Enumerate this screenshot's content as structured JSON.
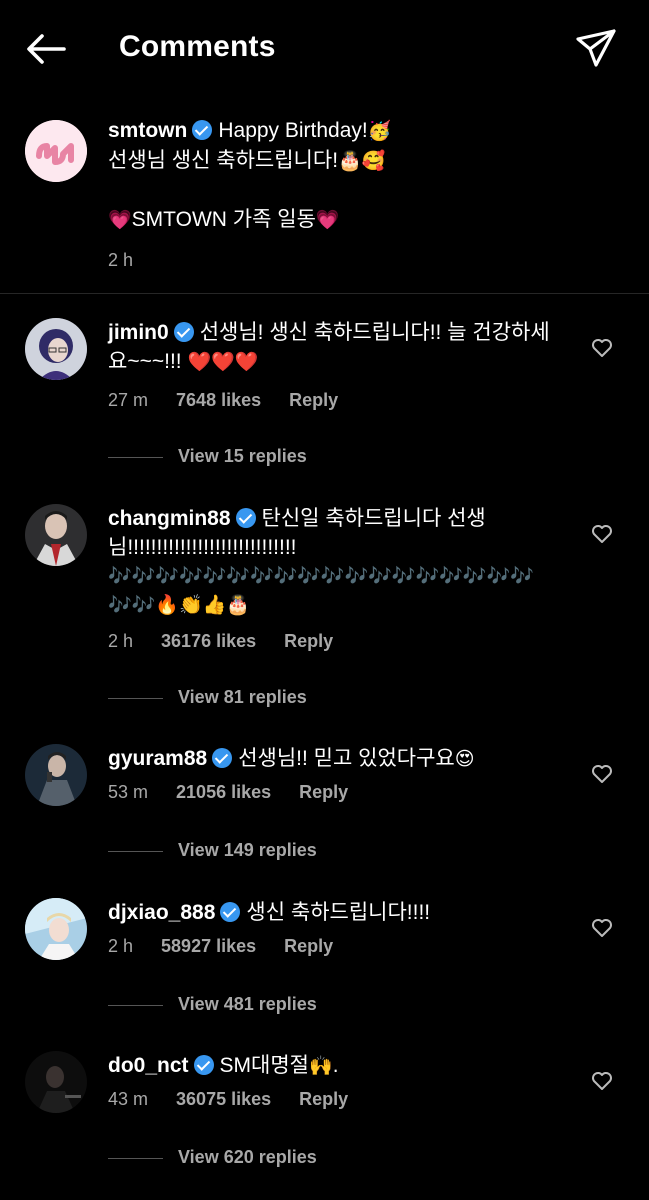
{
  "header": {
    "title": "Comments"
  },
  "caption": {
    "username": "smtown",
    "line1": "Happy Birthday!",
    "line1_emoji": "🥳",
    "line2": "선생님 생신 축하드립니다!",
    "line2_emoji": "🎂🥰",
    "line3_emoji_left": "💗",
    "line3": "SMTOWN 가족 일동",
    "line3_emoji_right": "💗",
    "time": "2 h"
  },
  "comments": [
    {
      "username": "jimin0",
      "text": "선생님! 생신 축하드립니다!! 늘 건강하세요~~~!!!",
      "emoji": "❤️❤️❤️",
      "time": "27 m",
      "likes": "7648 likes",
      "reply": "Reply",
      "view_replies": "View 15 replies"
    },
    {
      "username": "changmin88",
      "text": "탄신일 축하드립니다 선생님!!!!!!!!!!!!!!!!!!!!!!!!!!!!!",
      "emoji": "🎶🎶🎶🎶🎶🎶🎶🎶🎶🎶🎶🎶🎶🎶🎶🎶🎶🎶🎶🎶🔥👏👍🎂",
      "time": "2 h",
      "likes": "36176 likes",
      "reply": "Reply",
      "view_replies": "View 81 replies"
    },
    {
      "username": "gyuram88",
      "text": "선생님!! 믿고 있었다구요",
      "emoji": "😍",
      "time": "53 m",
      "likes": "21056 likes",
      "reply": "Reply",
      "view_replies": "View 149 replies"
    },
    {
      "username": "djxiao_888",
      "text": "생신 축하드립니다!!!!",
      "emoji": "",
      "time": "2 h",
      "likes": "58927 likes",
      "reply": "Reply",
      "view_replies": "View 481 replies"
    },
    {
      "username": "do0_nct",
      "text": "SM대명절",
      "emoji": "🙌.",
      "time": "43 m",
      "likes": "36075 likes",
      "reply": "Reply",
      "view_replies": "View 620 replies"
    }
  ]
}
